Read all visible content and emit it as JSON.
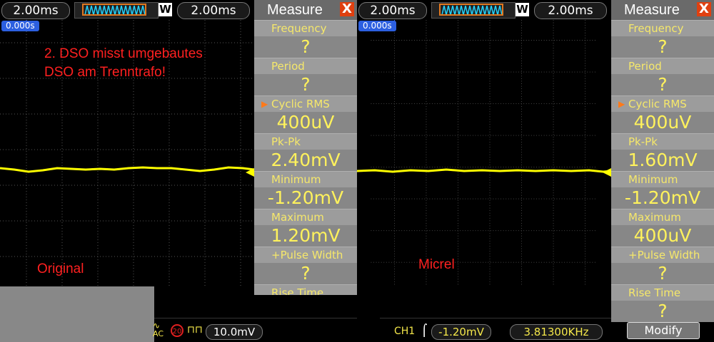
{
  "left": {
    "timebase": "2.00ms",
    "trigger_delay": "2.00ms",
    "trigger_mode_label": "W",
    "trigger_offset_tag": "0.000s",
    "annotation_line1": "2. DSO misst umgebautes",
    "annotation_line2": "DSO am Trenntrafo!",
    "label": "Original",
    "measure": {
      "title": "Measure",
      "close_label": "X",
      "items": [
        {
          "label": "Frequency",
          "value": "?"
        },
        {
          "label": "Period",
          "value": "?"
        },
        {
          "label": "Cyclic RMS",
          "value": "400uV",
          "selected": true
        },
        {
          "label": "Pk-Pk",
          "value": "2.40mV"
        },
        {
          "label": "Minimum",
          "value": "-1.20mV"
        },
        {
          "label": "Maximum",
          "value": "1.20mV"
        },
        {
          "label": "+Pulse Width",
          "value": "?"
        },
        {
          "label": "Rise Time",
          "value": ""
        }
      ]
    },
    "status": {
      "coupling": "AC",
      "bw_limit": "20",
      "volts_div": "10.0mV"
    }
  },
  "right": {
    "timebase": "2.00ms",
    "trigger_delay": "2.00ms",
    "trigger_mode_label": "W",
    "trigger_offset_tag": "0.000s",
    "label": "Micrel",
    "measure": {
      "title": "Measure",
      "close_label": "X",
      "items": [
        {
          "label": "Frequency",
          "value": "?"
        },
        {
          "label": "Period",
          "value": "?"
        },
        {
          "label": "Cyclic RMS",
          "value": "400uV",
          "selected": true
        },
        {
          "label": "Pk-Pk",
          "value": "1.60mV"
        },
        {
          "label": "Minimum",
          "value": "-1.20mV"
        },
        {
          "label": "Maximum",
          "value": "400uV"
        },
        {
          "label": "+Pulse Width",
          "value": "?"
        },
        {
          "label": "Rise Time",
          "value": "?"
        }
      ]
    },
    "status": {
      "channel": "CH1",
      "trigger_level": "-1.20mV",
      "frequency": "3.81300KHz"
    },
    "modify_label": "Modify"
  },
  "colors": {
    "trace": "#ffff00",
    "annotation": "#ff2020",
    "value_text": "#fff25c",
    "label_text": "#f6e86a",
    "trigger_tag": "#2c5fe0",
    "close_button": "#e04010"
  }
}
